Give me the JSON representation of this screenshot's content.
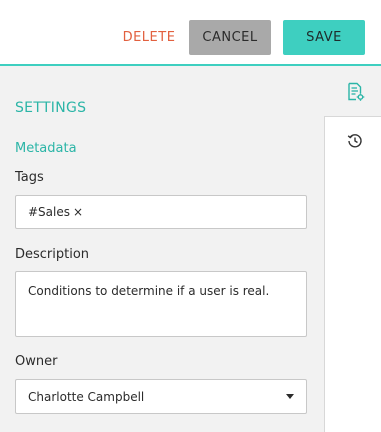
{
  "toolbar": {
    "delete_label": "DELETE",
    "cancel_label": "CANCEL",
    "save_label": "SAVE"
  },
  "settings": {
    "title": "SETTINGS",
    "metadata_heading": "Metadata",
    "tags": {
      "label": "Tags",
      "items": [
        {
          "text": "#Sales",
          "remove_glyph": "×"
        }
      ]
    },
    "description": {
      "label": "Description",
      "value": "Conditions to determine if a user is real."
    },
    "owner": {
      "label": "Owner",
      "selected": "Charlotte Campbell"
    }
  },
  "side_rail": {
    "tabs": [
      {
        "icon": "settings-document-icon",
        "active": true
      },
      {
        "icon": "history-icon",
        "active": false
      }
    ]
  },
  "colors": {
    "accent": "#3ecfc0",
    "accent_text": "#2bb5a7",
    "danger": "#e2603f",
    "cancel_bg": "#a9a9a9",
    "panel_bg": "#f2f2f2"
  }
}
